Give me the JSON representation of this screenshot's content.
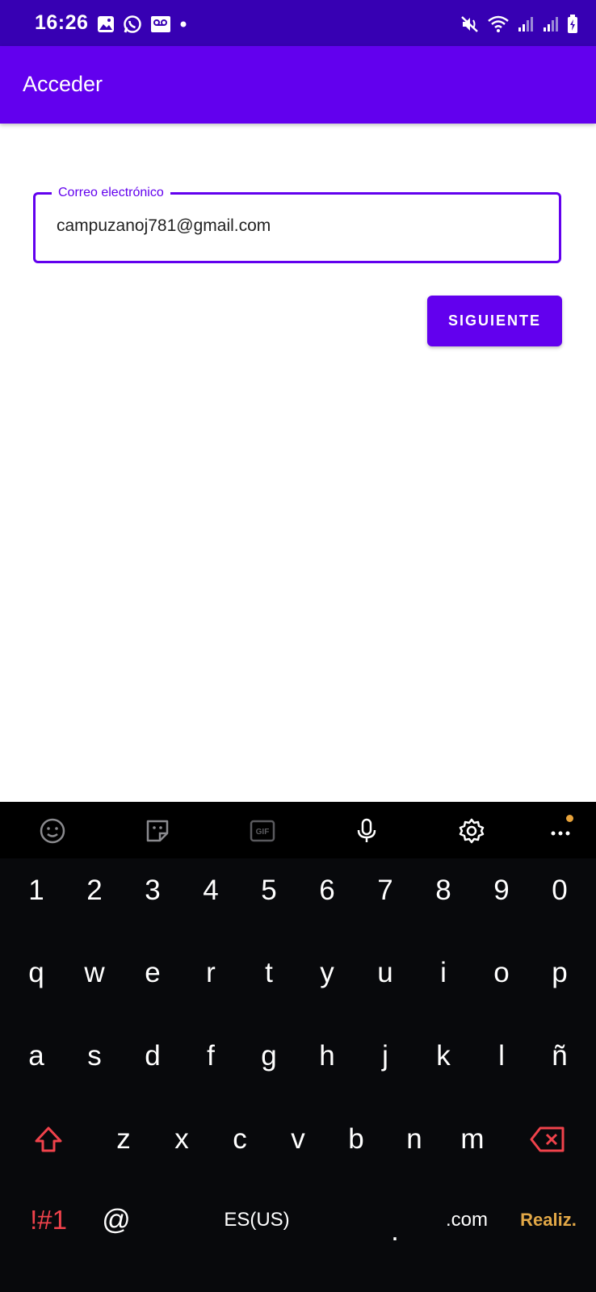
{
  "status_bar": {
    "time": "16:26"
  },
  "app_bar": {
    "title": "Acceder"
  },
  "form": {
    "email_label": "Correo electrónico",
    "email_value": "campuzanoj781@gmail.com",
    "next_button": "SIGUIENTE"
  },
  "keyboard": {
    "row_numbers": [
      "1",
      "2",
      "3",
      "4",
      "5",
      "6",
      "7",
      "8",
      "9",
      "0"
    ],
    "row_q": [
      "q",
      "w",
      "e",
      "r",
      "t",
      "y",
      "u",
      "i",
      "o",
      "p"
    ],
    "row_a": [
      "a",
      "s",
      "d",
      "f",
      "g",
      "h",
      "j",
      "k",
      "l",
      "ñ"
    ],
    "row_z": [
      "z",
      "x",
      "c",
      "v",
      "b",
      "n",
      "m"
    ],
    "symbols_key": "!#1",
    "at_key": "@",
    "language_key": "ES(US)",
    "period_key": ".",
    "dotcom_key": ".com",
    "done_key": "Realiz."
  },
  "colors": {
    "primary": "#6200EE",
    "primary_dark": "#3700B3",
    "keyboard_bg": "#08090C",
    "accent_red": "#F0424B",
    "accent_orange": "#E2A847"
  }
}
